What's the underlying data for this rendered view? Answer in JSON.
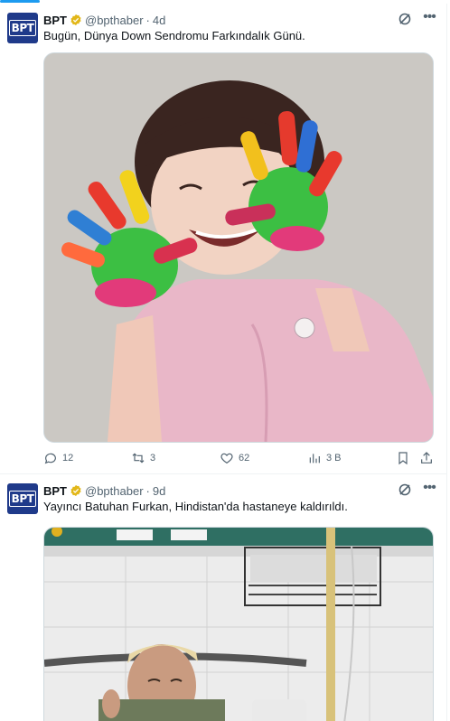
{
  "colors": {
    "accent": "#1d9bf0",
    "verified": "#e2b719",
    "muted": "#536471",
    "text": "#0f1419"
  },
  "tweets": [
    {
      "avatar_text": "BPT",
      "name": "BPT",
      "handle": "@bpthaber",
      "sep": "·",
      "time": "4d",
      "text": "Bugün, Dünya Down Sendromu Farkındalık Günü.",
      "replies": "12",
      "retweets": "3",
      "likes": "62",
      "views": "3 B"
    },
    {
      "avatar_text": "BPT",
      "name": "BPT",
      "handle": "@bpthaber",
      "sep": "·",
      "time": "9d",
      "text": "Yayıncı Batuhan Furkan, Hindistan'da hastaneye kaldırıldı."
    }
  ]
}
